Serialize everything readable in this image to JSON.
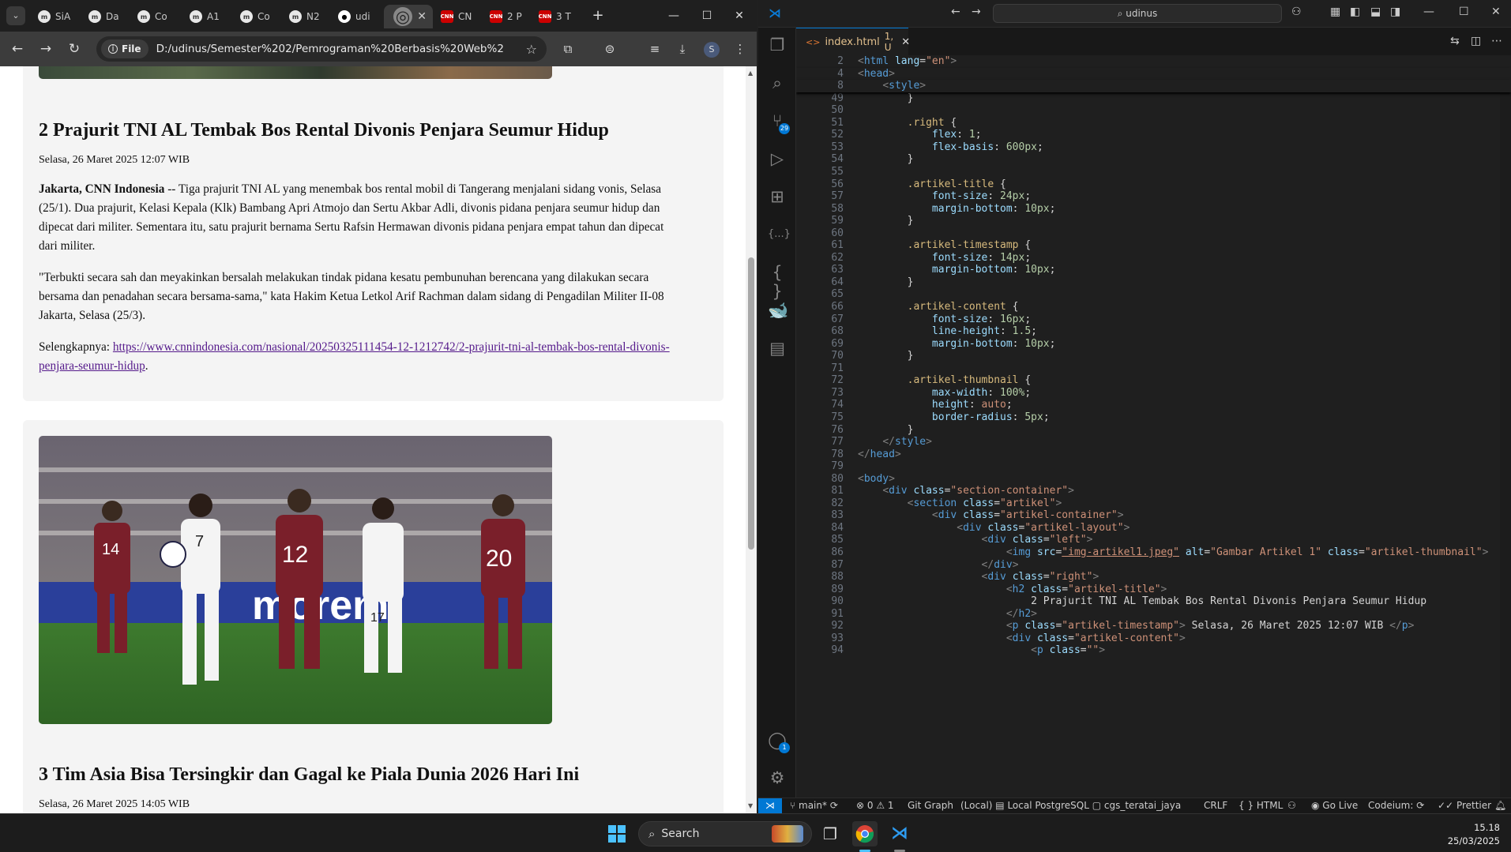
{
  "chrome": {
    "tabs": [
      {
        "label": "SiA",
        "fav": "g",
        "glyph": "m"
      },
      {
        "label": "Da",
        "fav": "g",
        "glyph": "m"
      },
      {
        "label": "Co",
        "fav": "g",
        "glyph": "m"
      },
      {
        "label": "A1",
        "fav": "g",
        "glyph": "m"
      },
      {
        "label": "Co",
        "fav": "g",
        "glyph": "m"
      },
      {
        "label": "N2",
        "fav": "g",
        "glyph": "m"
      },
      {
        "label": "udi",
        "fav": "gh",
        "glyph": "●"
      },
      {
        "label": "",
        "fav": "act",
        "glyph": "◎",
        "active": true
      },
      {
        "label": "CN",
        "fav": "cnn",
        "glyph": "CNN"
      },
      {
        "label": "2 P",
        "fav": "cnn",
        "glyph": "CNN"
      },
      {
        "label": "3 T",
        "fav": "cnn",
        "glyph": "CNN"
      }
    ],
    "file_chip": "File",
    "url": "D:/udinus/Semester%202/Pemrograman%20Berbasis%20Web%20-%20T...",
    "profile_initial": "S"
  },
  "article1": {
    "title": "2 Prajurit TNI AL Tembak Bos Rental Divonis Penjara Seumur Hidup",
    "timestamp": "Selasa, 26 Maret 2025 12:07 WIB",
    "p1_lead": "Jakarta, CNN Indonesia",
    "p1_line1": " -- Tiga prajurit TNI AL yang menembak bos rental mobil di Tangerang menjalani sidang vonis, Selasa",
    "p1_line2": "(25/1). Dua prajurit, Kelasi Kepala (Klk) Bambang Apri Atmojo dan Sertu Akbar Adli, divonis pidana penjara seumur hidup dan",
    "p1_line3": "dipecat dari militer. Sementara itu, satu prajurit bernama Sertu Rafsin Hermawan divonis pidana penjara empat tahun dan dipecat",
    "p1_line4": "dari militer.",
    "p2_line1": "\"Terbukti secara sah dan meyakinkan bersalah melakukan tindak pidana kesatu pembunuhan berencana yang dilakukan secara",
    "p2_line2": "bersama dan penadahan secara bersama-sama,\" kata Hakim Ketua Letkol Arif Rachman dalam sidang di Pengadilan Militer II-08",
    "p2_line3": "Jakarta, Selasa (25/3).",
    "more_label": "Selengkapnya: ",
    "more_link1": "https://www.cnnindonesia.com/nasional/20250325111454-12-1212742/2-prajurit-tni-al-tembak-bos-rental-divonis-",
    "more_link2": "penjara-seumur-hidup",
    "more_end": "."
  },
  "article2": {
    "title": "3 Tim Asia Bisa Tersingkir dan Gagal ke Piala Dunia 2026 Hari Ini",
    "timestamp": "Selasa, 26 Maret 2025 14:05 WIB",
    "jersey_numbers": [
      "7",
      "14",
      "12",
      "20",
      "17"
    ],
    "banner_text": "morem"
  },
  "vscode": {
    "search": "udinus",
    "tab_label": "index.html",
    "tab_status": "1, U",
    "scm_badge": "29",
    "accounts_badge": "1",
    "status": {
      "branch": "main*",
      "problems": "0",
      "warnings": "1",
      "git_graph": "Git Graph",
      "db": "(Local)",
      "db_name": "Local PostgreSQL",
      "db_schema": "cgs_teratai_jaya",
      "eol": "CRLF",
      "lang": "HTML",
      "golive": "Go Live",
      "codeium": "Codeium:",
      "prettier": "Prettier"
    },
    "lines": [
      {
        "n": "2",
        "html": "<span class=\"pu\">&lt;</span><span class=\"tg\">html</span> <span class=\"at\">lang</span>=<span class=\"st\">\"en\"</span><span class=\"pu\">&gt;</span>",
        "sticky": true
      },
      {
        "n": "4",
        "html": "<span class=\"pu\">&lt;</span><span class=\"tg\">head</span><span class=\"pu\">&gt;</span>",
        "sticky": true
      },
      {
        "n": "8",
        "html": "    <span class=\"pu\">&lt;</span><span class=\"tg\">style</span><span class=\"pu\">&gt;</span>",
        "sticky": true
      },
      {
        "n": "49",
        "html": "        }"
      },
      {
        "n": "50",
        "html": ""
      },
      {
        "n": "51",
        "html": "        <span class=\"sl\">.right</span> {"
      },
      {
        "n": "52",
        "html": "            <span class=\"pr\">flex</span>: <span class=\"nm\">1</span>;"
      },
      {
        "n": "53",
        "html": "            <span class=\"pr\">flex-basis</span>: <span class=\"nm\">600px</span>;"
      },
      {
        "n": "54",
        "html": "        }"
      },
      {
        "n": "55",
        "html": ""
      },
      {
        "n": "56",
        "html": "        <span class=\"sl\">.artikel-title</span> {"
      },
      {
        "n": "57",
        "html": "            <span class=\"pr\">font-size</span>: <span class=\"nm\">24px</span>;"
      },
      {
        "n": "58",
        "html": "            <span class=\"pr\">margin-bottom</span>: <span class=\"nm\">10px</span>;"
      },
      {
        "n": "59",
        "html": "        }"
      },
      {
        "n": "60",
        "html": ""
      },
      {
        "n": "61",
        "html": "        <span class=\"sl\">.artikel-timestamp</span> {"
      },
      {
        "n": "62",
        "html": "            <span class=\"pr\">font-size</span>: <span class=\"nm\">14px</span>;"
      },
      {
        "n": "63",
        "html": "            <span class=\"pr\">margin-bottom</span>: <span class=\"nm\">10px</span>;"
      },
      {
        "n": "64",
        "html": "        }"
      },
      {
        "n": "65",
        "html": ""
      },
      {
        "n": "66",
        "html": "        <span class=\"sl\">.artikel-content</span> {"
      },
      {
        "n": "67",
        "html": "            <span class=\"pr\">font-size</span>: <span class=\"nm\">16px</span>;"
      },
      {
        "n": "68",
        "html": "            <span class=\"pr\">line-height</span>: <span class=\"nm\">1.5</span>;"
      },
      {
        "n": "69",
        "html": "            <span class=\"pr\">margin-bottom</span>: <span class=\"nm\">10px</span>;"
      },
      {
        "n": "70",
        "html": "        }"
      },
      {
        "n": "71",
        "html": ""
      },
      {
        "n": "72",
        "html": "        <span class=\"sl\">.artikel-thumbnail</span> {"
      },
      {
        "n": "73",
        "html": "            <span class=\"pr\">max-width</span>: <span class=\"nm\">100%</span>;"
      },
      {
        "n": "74",
        "html": "            <span class=\"pr\">height</span>: <span class=\"kw\">auto</span>;"
      },
      {
        "n": "75",
        "html": "            <span class=\"pr\">border-radius</span>: <span class=\"nm\">5px</span>;"
      },
      {
        "n": "76",
        "html": "        }"
      },
      {
        "n": "77",
        "html": "    <span class=\"pu\">&lt;/</span><span class=\"tg\">style</span><span class=\"pu\">&gt;</span>"
      },
      {
        "n": "78",
        "html": "<span class=\"pu\">&lt;/</span><span class=\"tg\">head</span><span class=\"pu\">&gt;</span>"
      },
      {
        "n": "79",
        "html": ""
      },
      {
        "n": "80",
        "html": "<span class=\"pu\">&lt;</span><span class=\"tg\">body</span><span class=\"pu\">&gt;</span>"
      },
      {
        "n": "81",
        "html": "    <span class=\"pu\">&lt;</span><span class=\"tg\">div</span> <span class=\"at\">class</span>=<span class=\"st\">\"section-container\"</span><span class=\"pu\">&gt;</span>"
      },
      {
        "n": "82",
        "html": "        <span class=\"pu\">&lt;</span><span class=\"tg\">section</span> <span class=\"at\">class</span>=<span class=\"st\">\"artikel\"</span><span class=\"pu\">&gt;</span>"
      },
      {
        "n": "83",
        "html": "            <span class=\"pu\">&lt;</span><span class=\"tg\">div</span> <span class=\"at\">class</span>=<span class=\"st\">\"artikel-container\"</span><span class=\"pu\">&gt;</span>"
      },
      {
        "n": "84",
        "html": "                <span class=\"pu\">&lt;</span><span class=\"tg\">div</span> <span class=\"at\">class</span>=<span class=\"st\">\"artikel-layout\"</span><span class=\"pu\">&gt;</span>"
      },
      {
        "n": "85",
        "html": "                    <span class=\"pu\">&lt;</span><span class=\"tg\">div</span> <span class=\"at\">class</span>=<span class=\"st\">\"left\"</span><span class=\"pu\">&gt;</span>"
      },
      {
        "n": "86",
        "html": "                        <span class=\"pu\">&lt;</span><span class=\"tg\">img</span> <span class=\"at\">src</span>=<span class=\"st\" style=\"text-decoration:underline\">\"img-artikel1.jpeg\"</span> <span class=\"at\">alt</span>=<span class=\"st\">\"Gambar Artikel 1\"</span> <span class=\"at\">class</span>=<span class=\"st\">\"artikel-thumbnail\"</span><span class=\"pu\">&gt;</span>"
      },
      {
        "n": "87",
        "html": "                    <span class=\"pu\">&lt;/</span><span class=\"tg\">div</span><span class=\"pu\">&gt;</span>"
      },
      {
        "n": "88",
        "html": "                    <span class=\"pu\">&lt;</span><span class=\"tg\">div</span> <span class=\"at\">class</span>=<span class=\"st\">\"right\"</span><span class=\"pu\">&gt;</span>"
      },
      {
        "n": "89",
        "html": "                        <span class=\"pu\">&lt;</span><span class=\"tg\">h2</span> <span class=\"at\">class</span>=<span class=\"st\">\"artikel-title\"</span><span class=\"pu\">&gt;</span>"
      },
      {
        "n": "90",
        "html": "                            2 Prajurit TNI AL Tembak Bos Rental Divonis Penjara Seumur Hidup"
      },
      {
        "n": "91",
        "html": "                        <span class=\"pu\">&lt;/</span><span class=\"tg\">h2</span><span class=\"pu\">&gt;</span>"
      },
      {
        "n": "92",
        "html": "                        <span class=\"pu\">&lt;</span><span class=\"tg\">p</span> <span class=\"at\">class</span>=<span class=\"st\">\"artikel-timestamp\"</span><span class=\"pu\">&gt;</span> Selasa, 26 Maret 2025 12:07 WIB <span class=\"pu\">&lt;/</span><span class=\"tg\">p</span><span class=\"pu\">&gt;</span>"
      },
      {
        "n": "93",
        "html": "                        <span class=\"pu\">&lt;</span><span class=\"tg\">div</span> <span class=\"at\">class</span>=<span class=\"st\">\"artikel-content\"</span><span class=\"pu\">&gt;</span>"
      },
      {
        "n": "94",
        "html": "                            <span class=\"pu\">&lt;</span><span class=\"tg\">p</span> <span class=\"at\">class</span>=<span class=\"st\">\"\"</span><span class=\"pu\">&gt;</span>"
      }
    ]
  },
  "taskbar": {
    "search": "Search",
    "time": "15.18",
    "date": "25/03/2025"
  }
}
